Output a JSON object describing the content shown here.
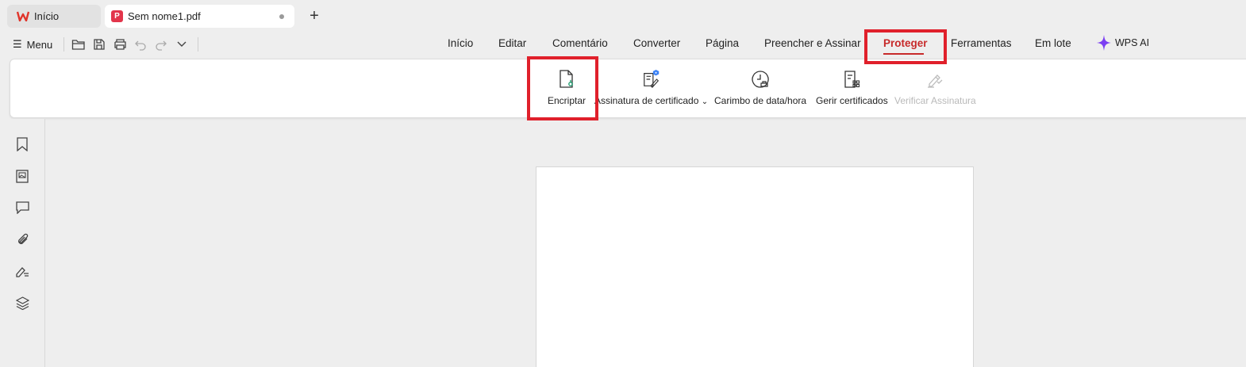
{
  "tabs": {
    "home_label": "Início",
    "doc_label": "Sem nome1.pdf",
    "pdf_badge": "P",
    "new_tab_symbol": "+"
  },
  "menu": {
    "label": "Menu",
    "hamburger": "☰"
  },
  "quick_access": [
    "open-folder-icon",
    "save-icon",
    "print-icon",
    "undo-icon",
    "redo-icon",
    "chevron-down-icon"
  ],
  "ribbon_tabs": [
    {
      "label": "Início"
    },
    {
      "label": "Editar"
    },
    {
      "label": "Comentário"
    },
    {
      "label": "Converter"
    },
    {
      "label": "Página"
    },
    {
      "label": "Preencher e Assinar"
    },
    {
      "label": "Proteger",
      "active": true
    },
    {
      "label": "Ferramentas"
    },
    {
      "label": "Em lote"
    },
    {
      "label": "WPS AI"
    }
  ],
  "tools": [
    {
      "label": "Encriptar",
      "icon": "encrypt-file-icon"
    },
    {
      "label": "Assinatura de certificado",
      "icon": "certificate-signature-icon",
      "dropdown": "⌄"
    },
    {
      "label": "Carimbo de data/hora",
      "icon": "timestamp-icon"
    },
    {
      "label": "Gerir certificados",
      "icon": "manage-certificates-icon"
    },
    {
      "label": "Verificar Assinatura",
      "icon": "verify-signature-icon",
      "disabled": true
    }
  ],
  "sidebar_icons": [
    "bookmark-icon",
    "thumbnail-icon",
    "comment-icon",
    "attachment-icon",
    "signature-icon",
    "layers-icon"
  ],
  "colors": {
    "accent": "#c72a2a",
    "highlight": "#e0202b",
    "pdf_brand": "#e2354b",
    "ai_purple": "#7b3ff2"
  }
}
